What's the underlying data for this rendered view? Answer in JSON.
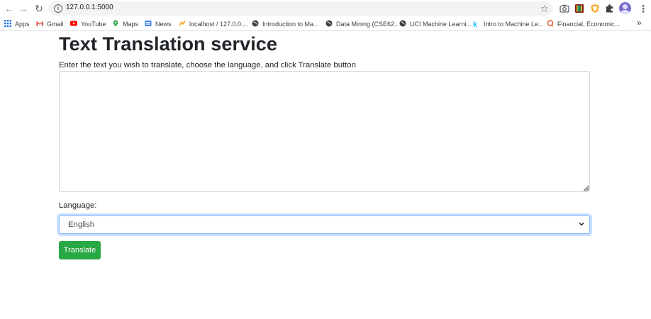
{
  "browser": {
    "url": "127.0.0.1:5000",
    "bookmarks": [
      {
        "label": "Apps",
        "icon": "apps-grid-icon"
      },
      {
        "label": "Gmail",
        "icon": "gmail-icon"
      },
      {
        "label": "YouTube",
        "icon": "youtube-icon"
      },
      {
        "label": "Maps",
        "icon": "maps-pin-icon"
      },
      {
        "label": "News",
        "icon": "news-icon"
      },
      {
        "label": "localhost / 127.0.0....",
        "icon": "phpmyadmin-icon"
      },
      {
        "label": "Introduction to Ma...",
        "icon": "globe-icon"
      },
      {
        "label": "Data Mining (CSE62...",
        "icon": "globe-icon"
      },
      {
        "label": "UCI Machine Learni...",
        "icon": "globe-icon"
      },
      {
        "label": "Intro to Machine Le...",
        "icon": "kaggle-icon"
      },
      {
        "label": "Financial, Economic...",
        "icon": "quandl-icon"
      }
    ]
  },
  "page": {
    "title": "Text Translation service",
    "subtitle": "Enter the text you wish to translate, choose the language, and click Translate button",
    "text_value": "",
    "language_label": "Language:",
    "language_selected": "English",
    "translate_label": "Translate"
  },
  "colors": {
    "accent_green": "#28a745",
    "focus_blue": "#86b7fe"
  }
}
